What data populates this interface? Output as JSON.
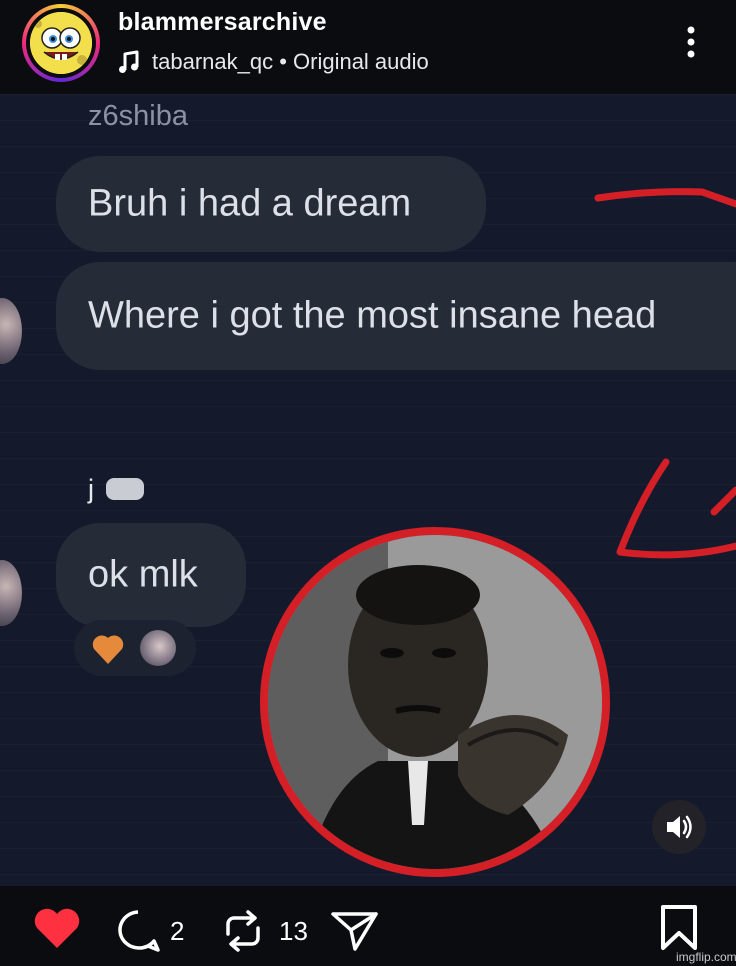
{
  "header": {
    "username": "blammersarchive",
    "audio_text": "tabarnak_qc • Original audio",
    "avatar_icon": "spongebob-avatar-icon",
    "more_icon": "more-vertical-icon"
  },
  "post": {
    "sender_name": "z6shiba",
    "messages": [
      "Bruh i had a dream",
      "Where i got the most insane head"
    ],
    "reply_name": "j",
    "reply_message": "ok mlk",
    "reaction_icon": "orange-heart-icon"
  },
  "actions": {
    "like_icon": "heart-filled-icon",
    "comment_icon": "comment-icon",
    "comment_count": "2",
    "repost_icon": "repost-icon",
    "repost_count": "13",
    "share_icon": "send-icon",
    "save_icon": "bookmark-icon"
  },
  "watermark": "imgflip.com",
  "colors": {
    "accent_red": "#d41f26",
    "like_red": "#ff3040",
    "bubble": "#262b38",
    "background": "#0b0c10"
  }
}
